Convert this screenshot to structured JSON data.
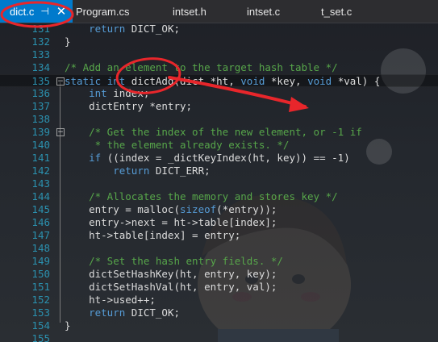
{
  "tabs": [
    {
      "label": "dict.c",
      "active": true
    },
    {
      "label": "Program.cs"
    },
    {
      "label": "intset.h"
    },
    {
      "label": "intset.c"
    },
    {
      "label": "t_set.c"
    }
  ],
  "lines": [
    {
      "n": "131",
      "code": "    return DICT_OK;"
    },
    {
      "n": "132",
      "code": "}"
    },
    {
      "n": "133",
      "code": ""
    },
    {
      "n": "134",
      "code": "/* Add an element to the target hash table */"
    },
    {
      "n": "135",
      "code": "static int dictAdd(dict *ht, void *key, void *val) {"
    },
    {
      "n": "136",
      "code": "    int index;"
    },
    {
      "n": "137",
      "code": "    dictEntry *entry;"
    },
    {
      "n": "138",
      "code": ""
    },
    {
      "n": "139",
      "code": "    /* Get the index of the new element, or -1 if"
    },
    {
      "n": "140",
      "code": "     * the element already exists. */"
    },
    {
      "n": "141",
      "code": "    if ((index = _dictKeyIndex(ht, key)) == -1)"
    },
    {
      "n": "142",
      "code": "        return DICT_ERR;"
    },
    {
      "n": "143",
      "code": ""
    },
    {
      "n": "144",
      "code": "    /* Allocates the memory and stores key */"
    },
    {
      "n": "145",
      "code": "    entry = malloc(sizeof(*entry));"
    },
    {
      "n": "146",
      "code": "    entry->next = ht->table[index];"
    },
    {
      "n": "147",
      "code": "    ht->table[index] = entry;"
    },
    {
      "n": "148",
      "code": ""
    },
    {
      "n": "149",
      "code": "    /* Set the hash entry fields. */"
    },
    {
      "n": "150",
      "code": "    dictSetHashKey(ht, entry, key);"
    },
    {
      "n": "151",
      "code": "    dictSetHashVal(ht, entry, val);"
    },
    {
      "n": "152",
      "code": "    ht->used++;"
    },
    {
      "n": "153",
      "code": "    return DICT_OK;"
    },
    {
      "n": "154",
      "code": "}"
    },
    {
      "n": "155",
      "code": ""
    }
  ],
  "colors": {
    "active_tab": "#007acc",
    "line_number": "#2b91af",
    "keyword": "#569cd6",
    "comment": "#57a64a",
    "text": "#dcdcdc",
    "annotation": "#e8262b"
  },
  "icons": {
    "pin": "pin-icon",
    "close": "close-icon"
  }
}
